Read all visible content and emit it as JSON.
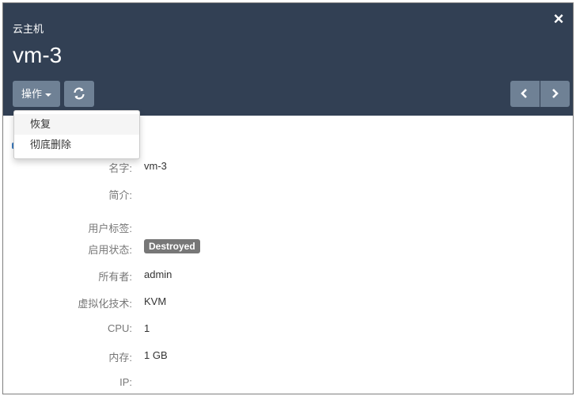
{
  "header": {
    "subtitle": "云主机",
    "title": "vm-3",
    "actions_label": "操作",
    "close_icon": "×"
  },
  "dropdown": {
    "items": [
      {
        "label": "恢复"
      },
      {
        "label": "彻底删除"
      }
    ]
  },
  "details": {
    "name": {
      "label": "名字:",
      "value": "vm-3"
    },
    "description": {
      "label": "简介:",
      "value": ""
    },
    "user_tags": {
      "label": "用户标签:",
      "value": ""
    },
    "state": {
      "label": "启用状态:",
      "value": "Destroyed"
    },
    "owner": {
      "label": "所有者:",
      "value": "admin"
    },
    "hypervisor": {
      "label": "虚拟化技术:",
      "value": "KVM"
    },
    "cpu": {
      "label": "CPU:",
      "value": "1"
    },
    "memory": {
      "label": "内存:",
      "value": "1 GB"
    },
    "ip": {
      "label": "IP:",
      "value": ""
    }
  },
  "colors": {
    "header_bg": "#324054",
    "button_bg": "#6f8195",
    "badge_bg": "#777777"
  }
}
